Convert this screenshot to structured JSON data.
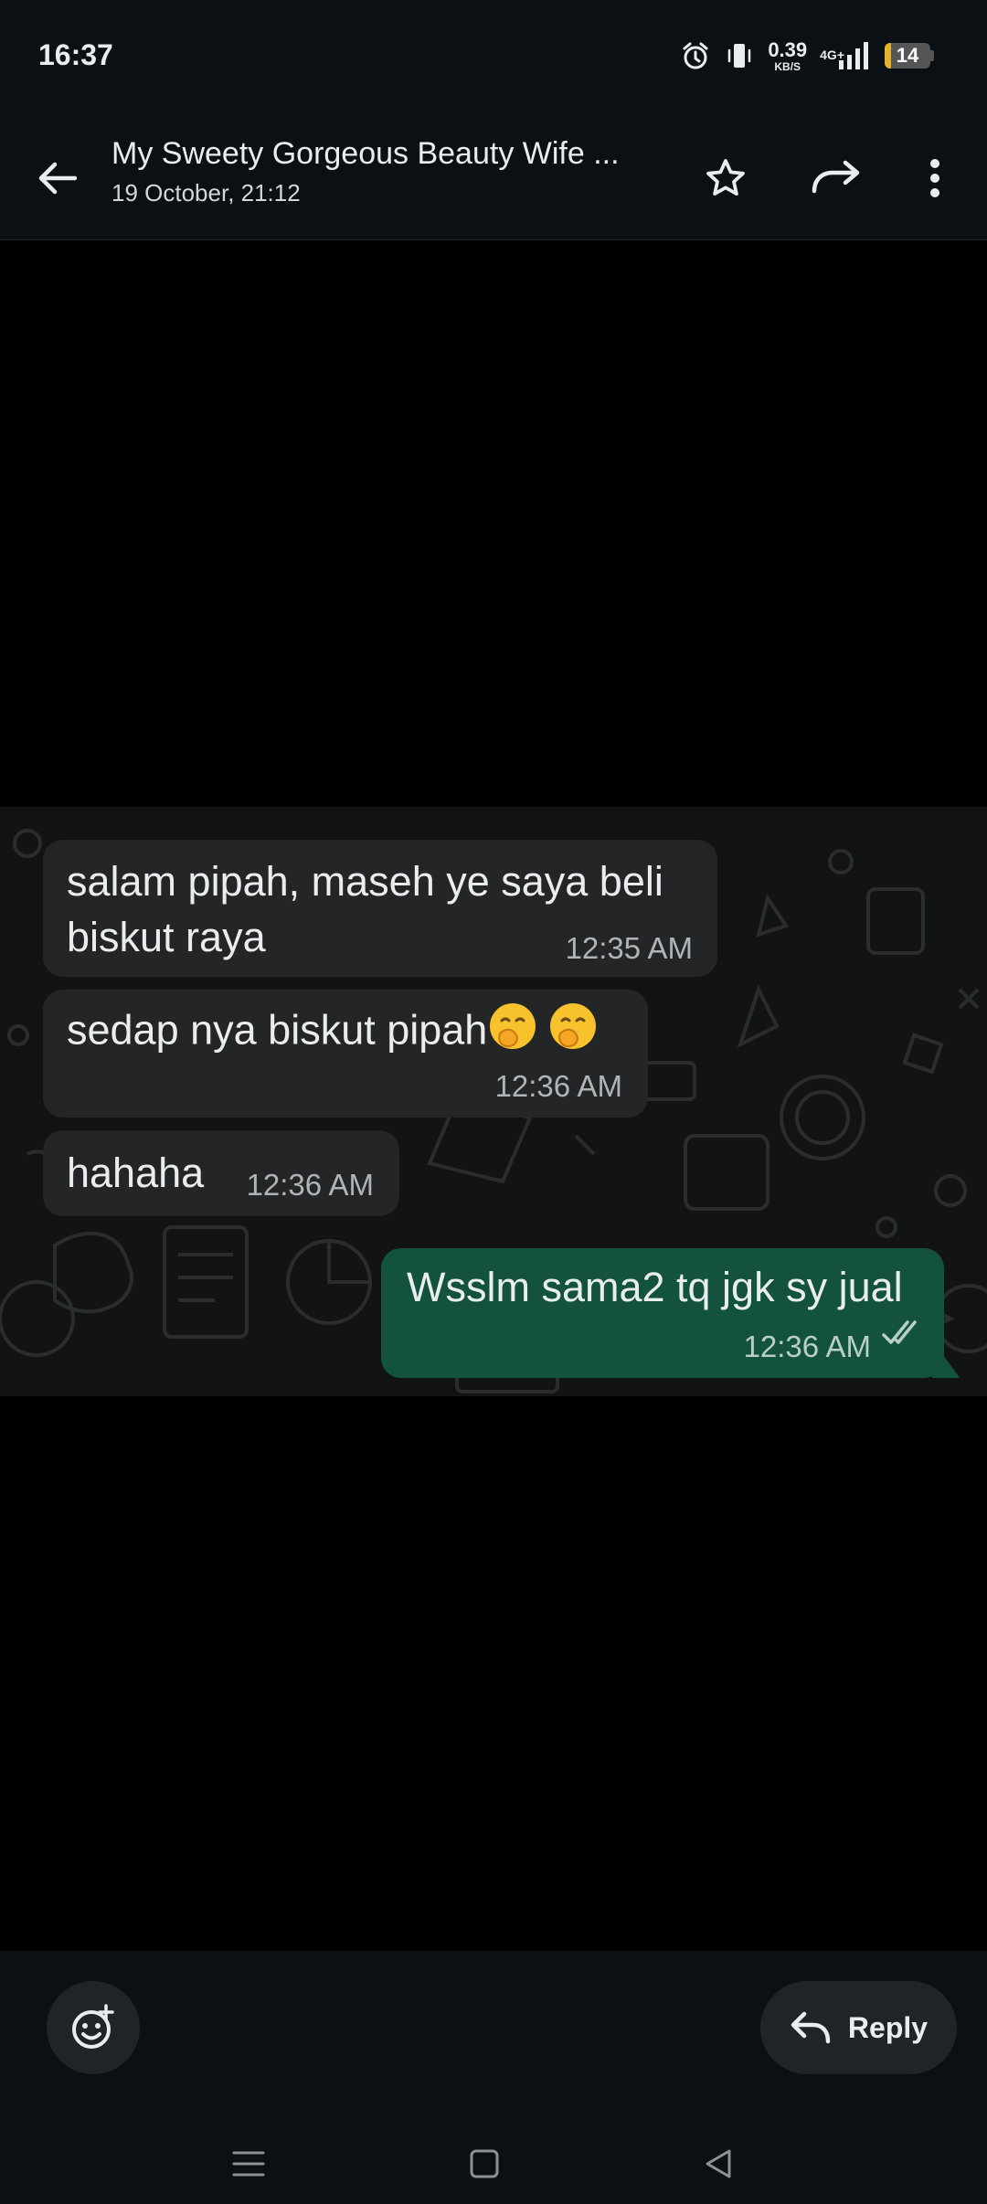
{
  "status_bar": {
    "time": "16:37",
    "net_speed_value": "0.39",
    "net_speed_unit": "KB/S",
    "network_type": "4G+",
    "battery_level": "14",
    "battery_fraction": 0.14,
    "icons": [
      "alarm-icon",
      "vibrate-icon",
      "signal-icon",
      "battery-icon"
    ]
  },
  "header": {
    "title": "My Sweety Gorgeous Beauty Wife ...",
    "subtitle": "19 October, 21:12",
    "icons": [
      "back-arrow-icon",
      "star-icon",
      "forward-icon",
      "more-vert-icon"
    ]
  },
  "messages": [
    {
      "direction": "incoming",
      "line1": "salam pipah, maseh ye saya beli",
      "line2": "biskut raya",
      "time": "12:35 AM"
    },
    {
      "direction": "incoming",
      "text": "sedap nya biskut pipah",
      "emojis": [
        "face-with-hand-over-mouth",
        "face-with-hand-over-mouth"
      ],
      "time": "12:36 AM"
    },
    {
      "direction": "incoming",
      "text": "hahaha",
      "time": "12:36 AM"
    },
    {
      "direction": "outgoing",
      "text": "Wsslm sama2 tq jgk sy jual",
      "time": "12:36 AM",
      "status": "read"
    }
  ],
  "bottom": {
    "reply_label": "Reply",
    "icons": [
      "add-reaction-icon",
      "reply-icon"
    ]
  },
  "nav": {
    "icons": [
      "menu-nav-icon",
      "home-nav-icon",
      "back-nav-icon"
    ]
  },
  "colors": {
    "incoming_bubble": "#232526",
    "outgoing_bubble": "#13523f",
    "header_bg": "#0b1014",
    "battery_low": "#e5b22b"
  }
}
